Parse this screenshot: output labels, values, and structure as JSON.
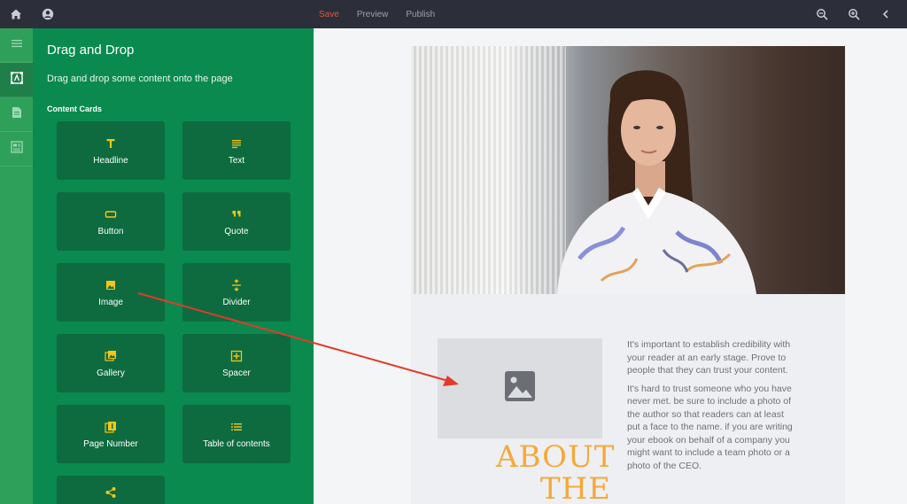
{
  "topbar": {
    "nav": [
      {
        "label": "Save",
        "active": true
      },
      {
        "label": "Preview",
        "active": false
      },
      {
        "label": "Publish",
        "active": false
      }
    ],
    "icons": [
      "home-icon",
      "account-icon",
      "zoom-out-icon",
      "zoom-in-icon",
      "chevron-left-icon"
    ]
  },
  "rail": {
    "icons": [
      "menu-icon",
      "content-cards-icon",
      "page-icon",
      "layout-icon"
    ],
    "active_index": 1
  },
  "panel": {
    "title": "Drag and Drop",
    "subtitle": "Drag and drop some content onto the page",
    "section": "Content Cards",
    "cards": [
      {
        "label": "Headline",
        "icon": "headline-icon"
      },
      {
        "label": "Text",
        "icon": "text-icon"
      },
      {
        "label": "Button",
        "icon": "button-icon"
      },
      {
        "label": "Quote",
        "icon": "quote-icon"
      },
      {
        "label": "Image",
        "icon": "image-icon"
      },
      {
        "label": "Divider",
        "icon": "divider-icon"
      },
      {
        "label": "Gallery",
        "icon": "gallery-icon"
      },
      {
        "label": "Spacer",
        "icon": "spacer-icon"
      },
      {
        "label": "Page Number",
        "icon": "page-number-icon"
      },
      {
        "label": "Table of contents",
        "icon": "table-of-contents-icon"
      },
      {
        "label": "",
        "icon": "share-icon"
      }
    ]
  },
  "page": {
    "heading": "ABOUT THE",
    "paragraphs": [
      "It's important to establish credibility with your reader at an early stage. Prove to people that they can trust your content.",
      "It's hard to trust someone who you have never met. be sure to include a photo of the author so that readers can at least put a face to the name. if you are writing your ebook on behalf of a company you might want to include a team photo or a photo of the CEO."
    ]
  },
  "colors": {
    "topbar": "#2c2f3a",
    "rail": "#2fa05a",
    "panel": "#0a8a4e",
    "card": "#0d6b3f",
    "accent": "#f5c518",
    "save": "#e8543a",
    "heading": "#f4a93a",
    "arrow": "#e23a2a"
  }
}
